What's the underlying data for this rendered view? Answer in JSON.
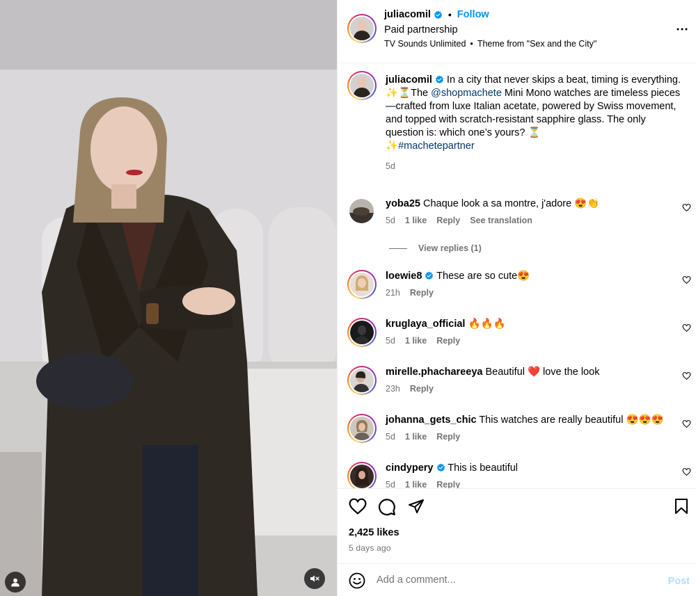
{
  "post": {
    "username": "juliacomil",
    "follow_label": "Follow",
    "paid_partnership": "Paid partnership",
    "audio_artist": "TV Sounds Unlimited",
    "audio_track": "Theme from \"Sex and the City\""
  },
  "caption": {
    "username": "juliacomil",
    "line1": "In a city that never skips a beat, timing is everything.",
    "line2_prefix": "✨⏳The ",
    "mention": "@shopmachete",
    "line2_rest": " Mini Mono watches are timeless pieces —crafted from luxe Italian acetate, powered by Swiss movement, and topped with scratch-resistant sapphire glass. The only question is: which one’s yours? ⏳",
    "hashtag_prefix": "✨",
    "hashtag": "#machetepartner",
    "time": "5d"
  },
  "comments": [
    {
      "username": "yoba25",
      "text": "Chaque look a sa montre, j'adore 😍👏",
      "time": "5d",
      "likes": "1 like",
      "reply": "Reply",
      "extra": "See translation",
      "verified": false
    },
    {
      "username": "loewie8",
      "text": "These are so cute😍",
      "time": "21h",
      "likes": "",
      "reply": "Reply",
      "extra": "",
      "verified": true
    },
    {
      "username": "kruglaya_official",
      "text": "🔥🔥🔥",
      "time": "5d",
      "likes": "1 like",
      "reply": "Reply",
      "extra": "",
      "verified": false
    },
    {
      "username": "mirelle.phachareeya",
      "text": "Beautiful ❤️ love the look",
      "time": "23h",
      "likes": "",
      "reply": "Reply",
      "extra": "",
      "verified": false
    },
    {
      "username": "johanna_gets_chic",
      "text": "This watches are really beautiful 😍😍😍",
      "time": "5d",
      "likes": "1 like",
      "reply": "Reply",
      "extra": "",
      "verified": false
    },
    {
      "username": "cindypery",
      "text": "This is beautiful",
      "time": "5d",
      "likes": "1 like",
      "reply": "Reply",
      "extra": "",
      "verified": true
    }
  ],
  "view_replies": "View replies (1)",
  "stats": {
    "likes": "2,425 likes",
    "posted": "5 days ago"
  },
  "composer": {
    "placeholder": "Add a comment...",
    "post_label": "Post"
  },
  "colors": {
    "accent": "#0095f6",
    "link": "#00376b",
    "secondary_text": "#737373",
    "verified": "#0095f6"
  }
}
